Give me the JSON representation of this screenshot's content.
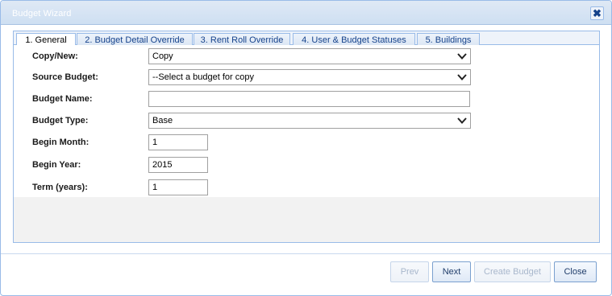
{
  "dialog": {
    "title": "Budget Wizard",
    "close_symbol": "✖"
  },
  "tabs": [
    {
      "label": "1. General",
      "active": true
    },
    {
      "label": "2. Budget Detail Override",
      "active": false
    },
    {
      "label": "3. Rent Roll Override",
      "active": false
    },
    {
      "label": "4. User & Budget Statuses",
      "active": false
    },
    {
      "label": "5. Buildings",
      "active": false
    }
  ],
  "form": {
    "copy_new": {
      "label": "Copy/New:",
      "value": "Copy"
    },
    "source_budget": {
      "label": "Source Budget:",
      "value": "--Select a budget for copy"
    },
    "budget_name": {
      "label": "Budget Name:",
      "value": ""
    },
    "budget_type": {
      "label": "Budget Type:",
      "value": "Base"
    },
    "begin_month": {
      "label": "Begin Month:",
      "value": "1"
    },
    "begin_year": {
      "label": "Begin Year:",
      "value": "2015"
    },
    "term_years": {
      "label": "Term (years):",
      "value": "1"
    }
  },
  "buttons": {
    "prev": "Prev",
    "next": "Next",
    "create_budget": "Create Budget",
    "close": "Close"
  },
  "icons": {
    "dropdown": "chevron-down-icon",
    "close": "close-icon"
  }
}
